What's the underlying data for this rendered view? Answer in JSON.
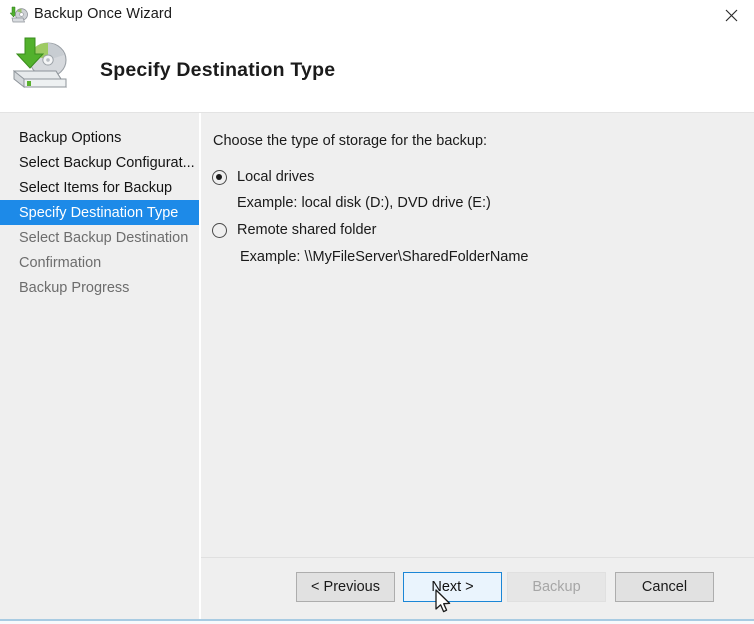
{
  "window": {
    "title": "Backup Once Wizard",
    "title_icon": "backup-wizard-icon",
    "close_icon": "close-icon"
  },
  "header": {
    "title": "Specify Destination Type",
    "icon": "backup-to-disk-icon"
  },
  "sidebar": {
    "items": [
      {
        "label": "Backup Options",
        "state": "done"
      },
      {
        "label": "Select Backup Configurat...",
        "state": "done"
      },
      {
        "label": "Select Items for Backup",
        "state": "done"
      },
      {
        "label": "Specify Destination Type",
        "state": "active"
      },
      {
        "label": "Select Backup Destination",
        "state": "future"
      },
      {
        "label": "Confirmation",
        "state": "future"
      },
      {
        "label": "Backup Progress",
        "state": "future"
      }
    ],
    "active_color": "#1d8ae8"
  },
  "main": {
    "prompt": "Choose the type of storage for the backup:",
    "options": [
      {
        "label": "Local drives",
        "example": "Example: local disk (D:), DVD drive (E:)",
        "selected": true
      },
      {
        "label": "Remote shared folder",
        "example": "Example: \\\\MyFileServer\\SharedFolderName",
        "selected": false
      }
    ]
  },
  "footer": {
    "buttons": [
      {
        "label": "< Previous",
        "state": "normal"
      },
      {
        "label": "Next >",
        "state": "focused"
      },
      {
        "label": "Backup",
        "state": "disabled"
      },
      {
        "label": "Cancel",
        "state": "normal"
      }
    ]
  }
}
